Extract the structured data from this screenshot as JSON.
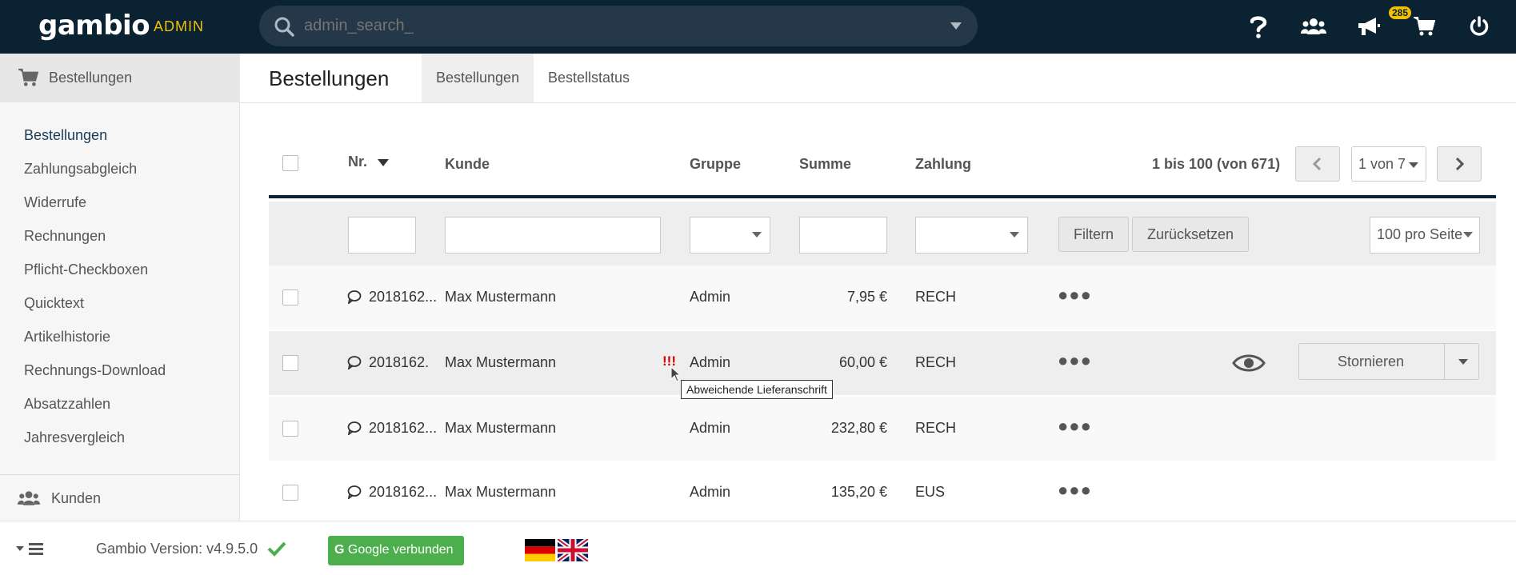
{
  "topbar": {
    "logo": "gambio",
    "admin_label": "ADMIN",
    "search_placeholder": "admin_search_",
    "notification_count": "285"
  },
  "sidebar": {
    "section_title": "Bestellungen",
    "items": [
      "Bestellungen",
      "Zahlungsabgleich",
      "Widerrufe",
      "Rechnungen",
      "Pflicht-Checkboxen",
      "Quicktext",
      "Artikelhistorie",
      "Rechnungs-Download",
      "Absatzzahlen",
      "Jahresvergleich"
    ],
    "next_section": "Kunden"
  },
  "page": {
    "title": "Bestellungen",
    "tabs": [
      "Bestellungen",
      "Bestellstatus"
    ]
  },
  "table": {
    "columns": {
      "nr": "Nr.",
      "kunde": "Kunde",
      "gruppe": "Gruppe",
      "summe": "Summe",
      "zahlung": "Zahlung"
    },
    "pager_info": "1 bis 100 (von 671)",
    "page_select": "1 von 7",
    "filter_button": "Filtern",
    "reset_button": "Zurücksetzen",
    "per_page": "100 pro Seite",
    "rows": [
      {
        "nr": "2018162...",
        "kunde": "Max Mustermann",
        "gruppe": "Admin",
        "summe": "7,95 €",
        "zahlung": "RECH"
      },
      {
        "nr": "2018162.",
        "kunde": "Max Mustermann",
        "gruppe": "Admin",
        "summe": "60,00 €",
        "zahlung": "RECH",
        "alert": "!!!",
        "action": "Stornieren"
      },
      {
        "nr": "2018162...",
        "kunde": "Max Mustermann",
        "gruppe": "Admin",
        "summe": "232,80 €",
        "zahlung": "RECH"
      },
      {
        "nr": "2018162...",
        "kunde": "Max Mustermann",
        "gruppe": "Admin",
        "summe": "135,20 €",
        "zahlung": "EUS"
      }
    ],
    "tooltip": "Abweichende Lieferanschrift"
  },
  "footer": {
    "version": "Gambio Version: v4.9.5.0",
    "google_button": "Google verbunden"
  },
  "colors": {
    "topbar": "#0b2233",
    "accent": "#f2c000",
    "google": "#4cae4c",
    "alert": "#d40000"
  }
}
